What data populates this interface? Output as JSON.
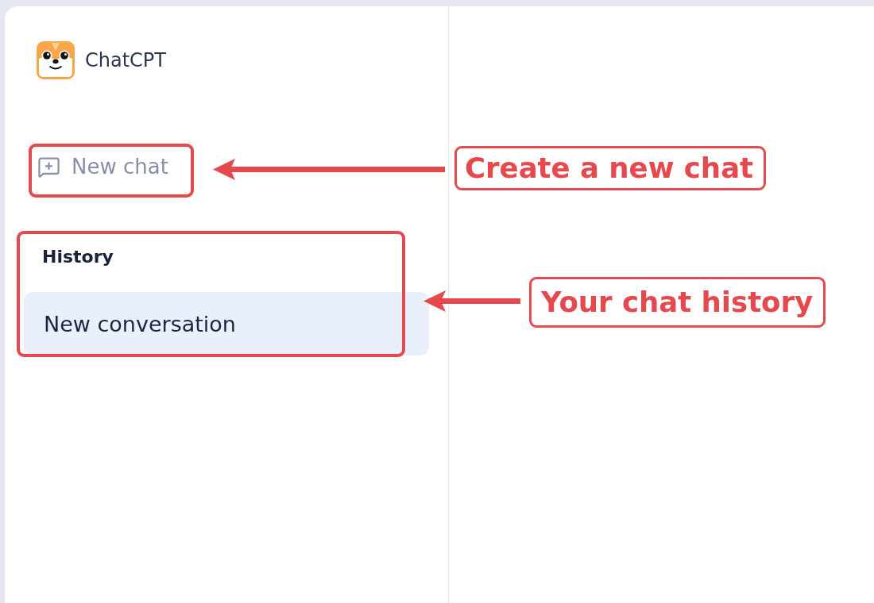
{
  "brand": {
    "name": "ChatCPT"
  },
  "sidebar": {
    "new_chat": {
      "label": "New chat"
    },
    "history": {
      "heading": "History",
      "items": [
        {
          "title": "New conversation",
          "selected": true
        }
      ]
    }
  },
  "annotations": [
    {
      "text": "Create a new chat"
    },
    {
      "text": "Your chat history"
    }
  ]
}
